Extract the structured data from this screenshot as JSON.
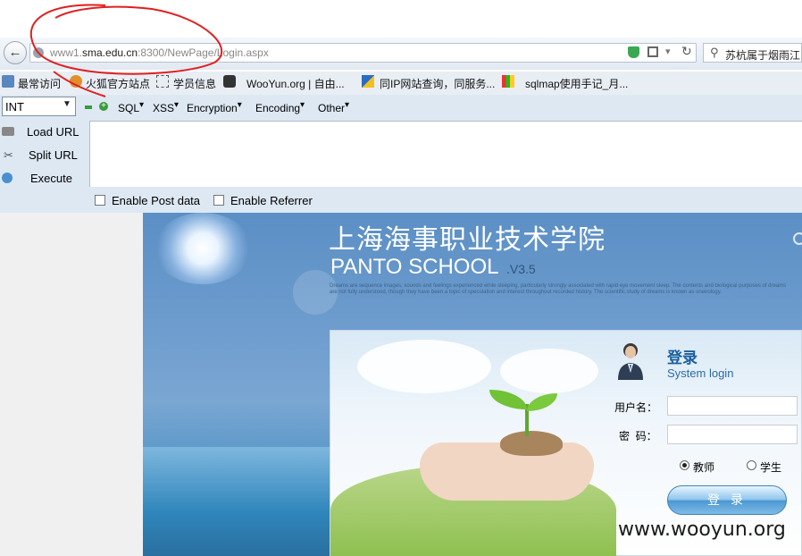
{
  "address_bar": {
    "url_prefix": "www1.",
    "url_domain": "sma.edu.cn",
    "url_rest": ":8300/NewPage/Login.aspx",
    "search_text": "苏杭属于烟雨江"
  },
  "bookmarks": [
    {
      "label": "最常访问"
    },
    {
      "label": "火狐官方站点"
    },
    {
      "label": "学员信息"
    },
    {
      "label": "WooYun.org | 自由..."
    },
    {
      "label": "同IP网站查询，同服务..."
    },
    {
      "label": "sqlmap使用手记_月..."
    }
  ],
  "hackbar": {
    "select_value": "INT",
    "menus": [
      "SQL",
      "XSS",
      "Encryption",
      "Encoding",
      "Other"
    ],
    "load_url": "Load URL",
    "split_url": "Split URL",
    "execute": "Execute",
    "enable_post": "Enable Post data",
    "enable_referrer": "Enable Referrer"
  },
  "page": {
    "school_cn": "上海海事职业技术学院",
    "school_en": "PANTO SCHOOL",
    "version": ".V3.5",
    "description": "Dreams are sequence images, sounds and feelings experienced while sleeping, particularly strongly associated with rapid eye movement sleep. The contents and biological purposes of dreams are not fully understood, though they have been a topic of speculation and interest throughout recorded history. The scientific study of dreams is known as oneirology.",
    "login_title": "登录",
    "login_subtitle": "System login",
    "username_label": "用户名：",
    "password_label": "密  码：",
    "role_teacher": "教师",
    "role_student": "学生",
    "selected_role": "teacher",
    "login_button": "登 录"
  },
  "watermark": "www.wooyun.org",
  "colors": {
    "annotation": "#e02020",
    "title_blue": "#1a5f9e"
  }
}
